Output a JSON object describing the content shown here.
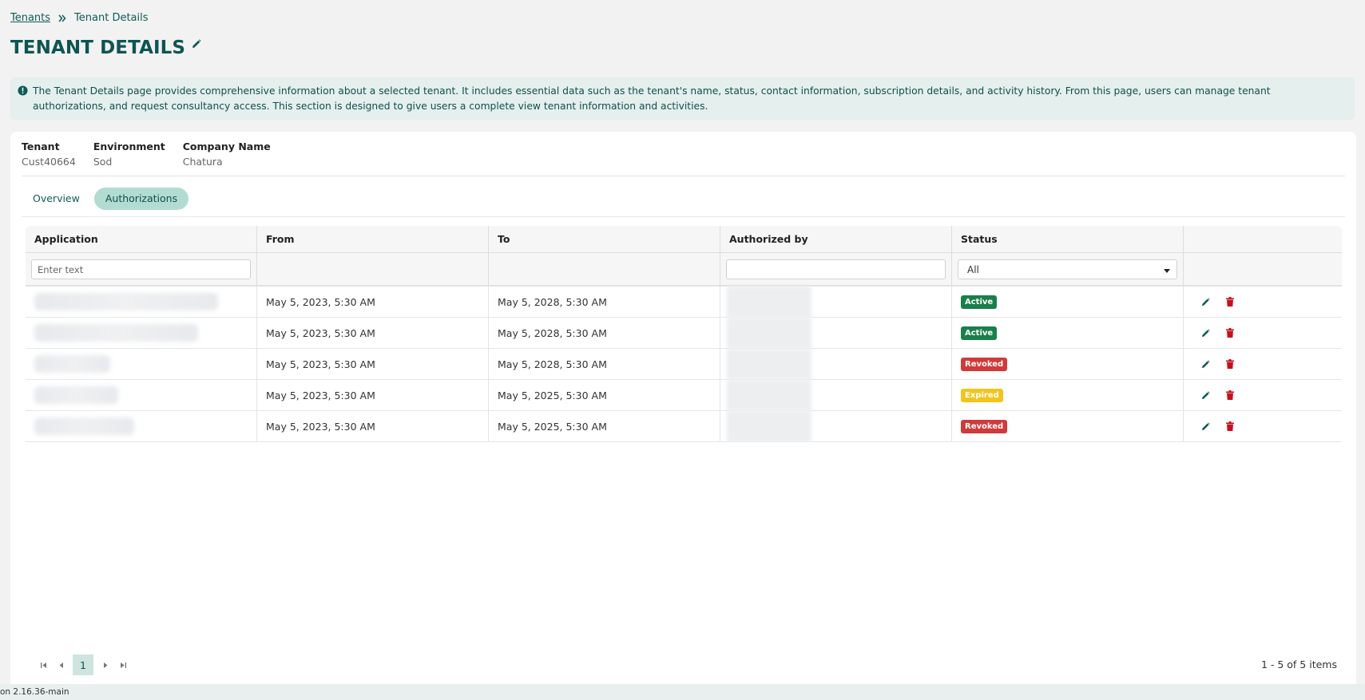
{
  "breadcrumb": {
    "parent": "Tenants",
    "current": "Tenant Details"
  },
  "page": {
    "title": "TENANT DETAILS"
  },
  "info": {
    "text": "The Tenant Details page provides comprehensive information about a selected tenant. It includes essential data such as the tenant's name, status, contact information, subscription details, and activity history. From this page, users can manage tenant authorizations, and request consultancy access. This section is designed to give users a complete view tenant information and activities."
  },
  "meta": [
    {
      "label": "Tenant",
      "value": "Cust40664"
    },
    {
      "label": "Environment",
      "value": "Sod"
    },
    {
      "label": "Company Name",
      "value": "Chatura"
    }
  ],
  "tabs": [
    {
      "label": "Overview",
      "active": false
    },
    {
      "label": "Authorizations",
      "active": true
    }
  ],
  "table": {
    "columns": [
      "Application",
      "From",
      "To",
      "Authorized by",
      "Status",
      ""
    ],
    "filters": {
      "application_placeholder": "Enter text",
      "authorized_value": "",
      "status_selected": "All"
    },
    "rows": [
      {
        "from": "May 5, 2023, 5:30 AM",
        "to": "May 5, 2028, 5:30 AM",
        "status": "Active"
      },
      {
        "from": "May 5, 2023, 5:30 AM",
        "to": "May 5, 2028, 5:30 AM",
        "status": "Active"
      },
      {
        "from": "May 5, 2023, 5:30 AM",
        "to": "May 5, 2028, 5:30 AM",
        "status": "Revoked"
      },
      {
        "from": "May 5, 2023, 5:30 AM",
        "to": "May 5, 2025, 5:30 AM",
        "status": "Expired"
      },
      {
        "from": "May 5, 2023, 5:30 AM",
        "to": "May 5, 2025, 5:30 AM",
        "status": "Revoked"
      }
    ]
  },
  "pagination": {
    "current_page": "1",
    "summary": "1 - 5 of 5 items"
  },
  "footer": {
    "version": "on 2.16.36-main"
  },
  "colors": {
    "brand": "#0d5552",
    "active": "#1a7f4b",
    "revoked": "#d13a3a",
    "expired": "#f2c51d",
    "delete": "#c8101c"
  }
}
